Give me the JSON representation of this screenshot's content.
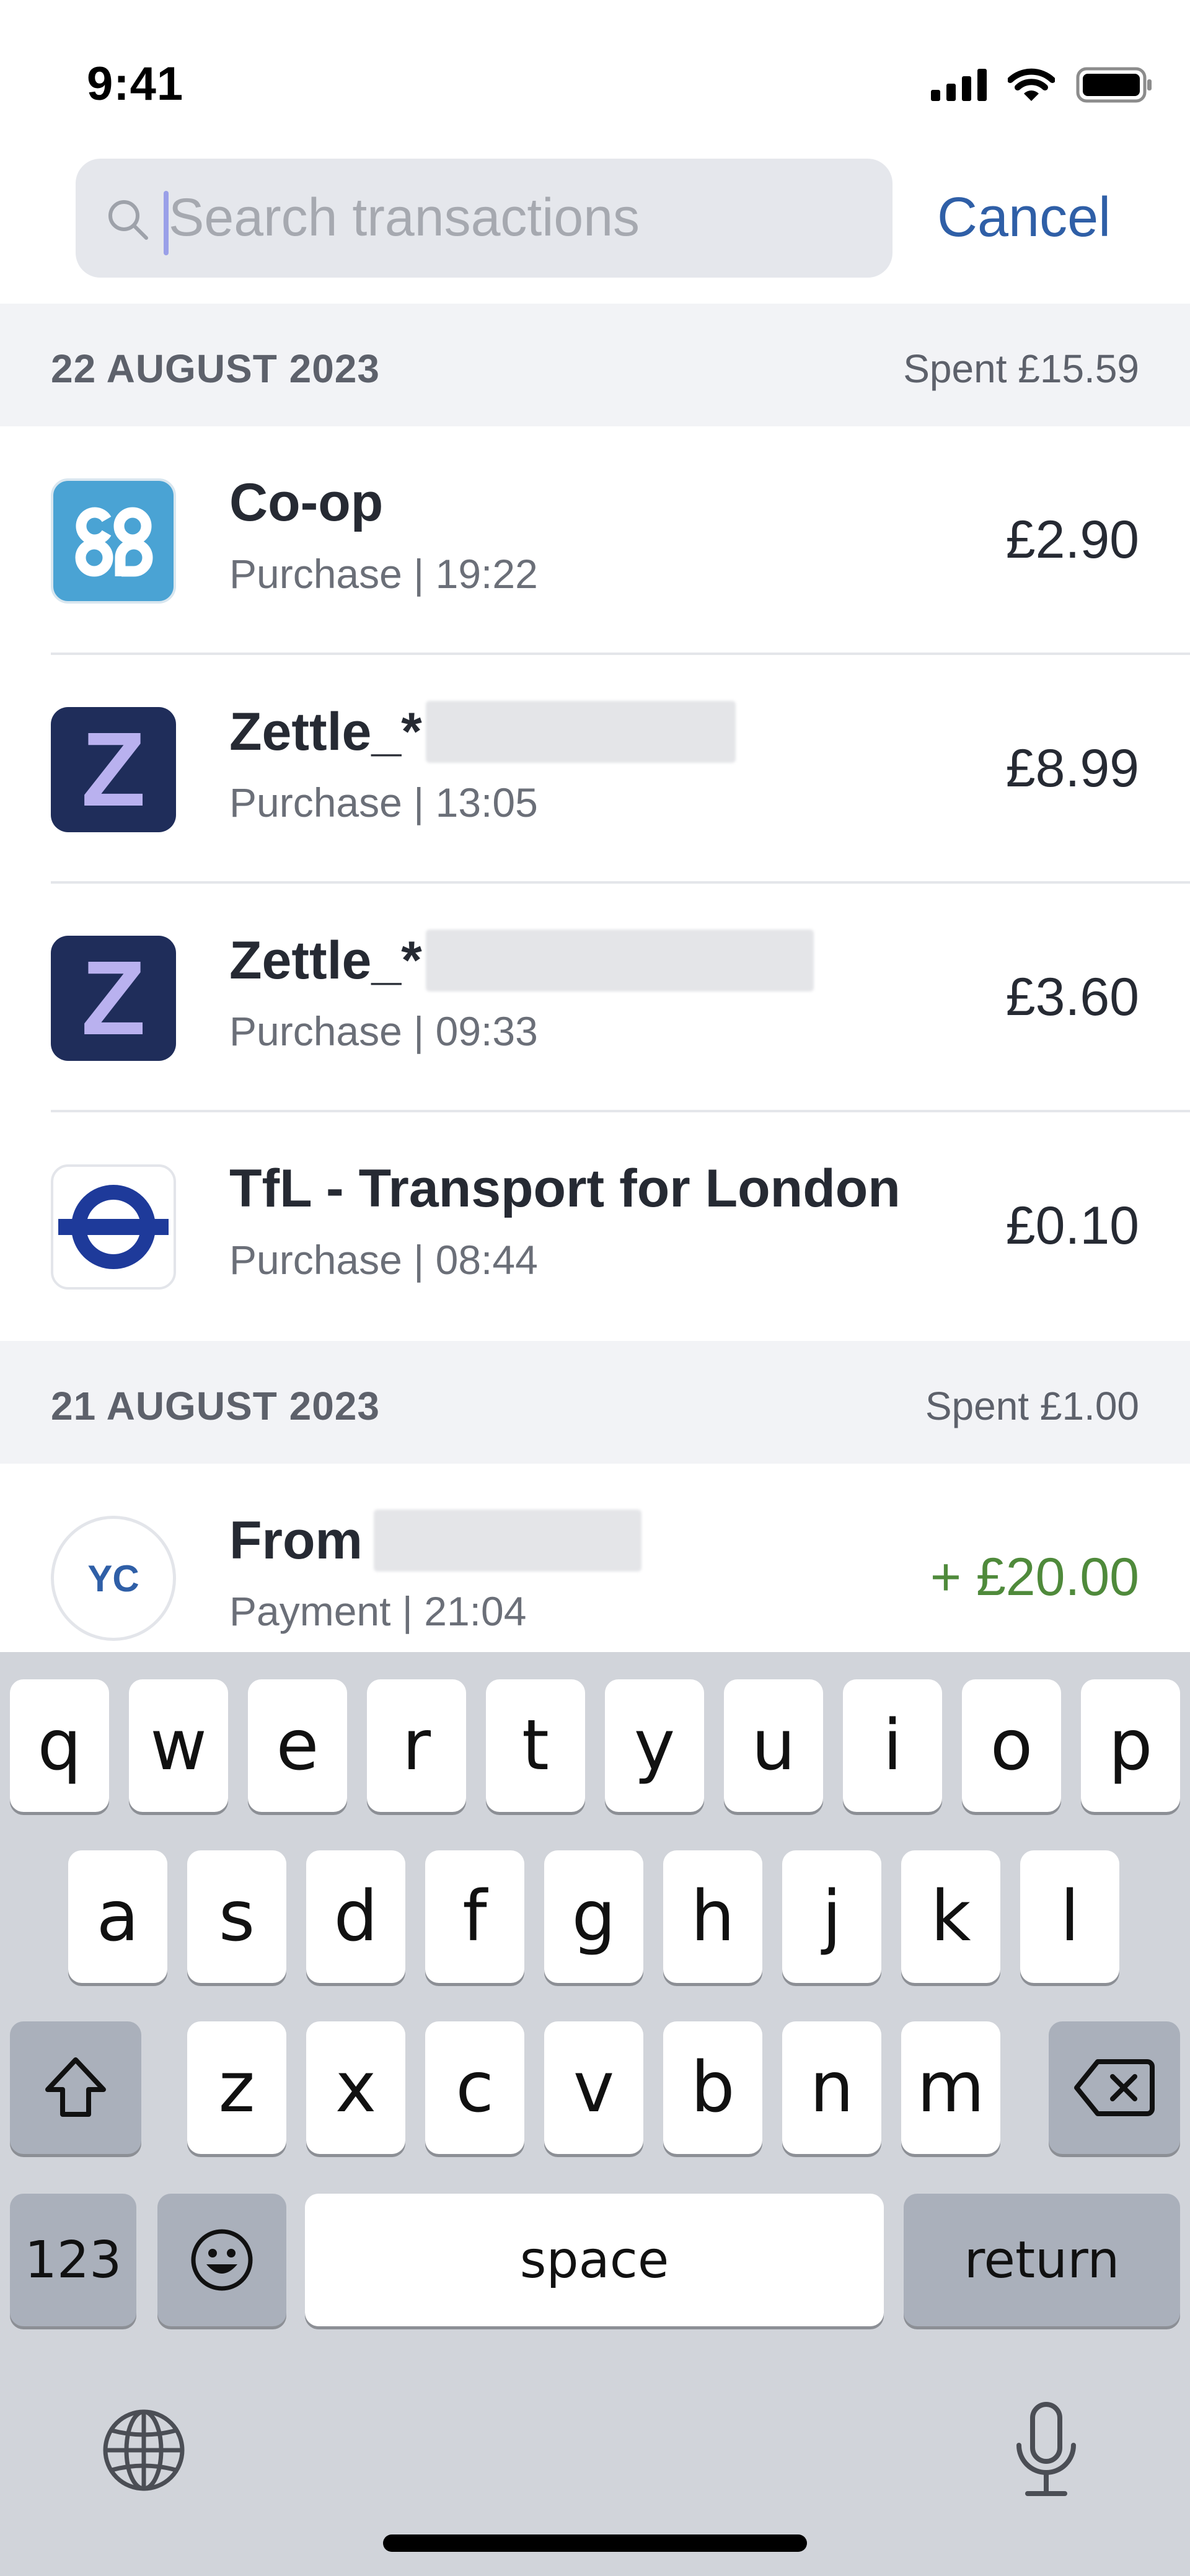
{
  "status_bar": {
    "time": "9:41"
  },
  "search": {
    "placeholder": "Search transactions",
    "value": "",
    "cancel_label": "Cancel"
  },
  "sections": [
    {
      "date": "22 AUGUST 2023",
      "spent": "Spent £15.59",
      "transactions": [
        {
          "merchant": "Co-op",
          "meta": "Purchase | 19:22",
          "amount": "£2.90",
          "logo": "coop-logo"
        },
        {
          "merchant": "Zettle_*",
          "meta": "Purchase | 13:05",
          "amount": "£8.99",
          "logo": "zettle-logo",
          "logo_text": "Z"
        },
        {
          "merchant": "Zettle_*",
          "meta": "Purchase | 09:33",
          "amount": "£3.60",
          "logo": "zettle-logo",
          "logo_text": "Z"
        },
        {
          "merchant": "TfL - Transport for London",
          "meta": "Purchase | 08:44",
          "amount": "£0.10",
          "logo": "tfl-roundel-logo"
        }
      ]
    },
    {
      "date": "21 AUGUST 2023",
      "spent": "Spent £1.00",
      "transactions": [
        {
          "merchant": "From",
          "meta": "Payment | 21:04",
          "amount": "+ £20.00",
          "logo": "initials-avatar",
          "logo_text": "YC"
        }
      ]
    }
  ],
  "keyboard": {
    "row1": [
      "q",
      "w",
      "e",
      "r",
      "t",
      "y",
      "u",
      "i",
      "o",
      "p"
    ],
    "row2": [
      "a",
      "s",
      "d",
      "f",
      "g",
      "h",
      "j",
      "k",
      "l"
    ],
    "row3": [
      "z",
      "x",
      "c",
      "v",
      "b",
      "n",
      "m"
    ],
    "numbers_label": "123",
    "space_label": "space",
    "return_label": "return"
  },
  "colors": {
    "accent": "#2f5fa7",
    "credit": "#4f8a3b",
    "coop": "#4aa3d4",
    "zettle": "#1f2d5a",
    "tfl": "#1e3a9a"
  }
}
